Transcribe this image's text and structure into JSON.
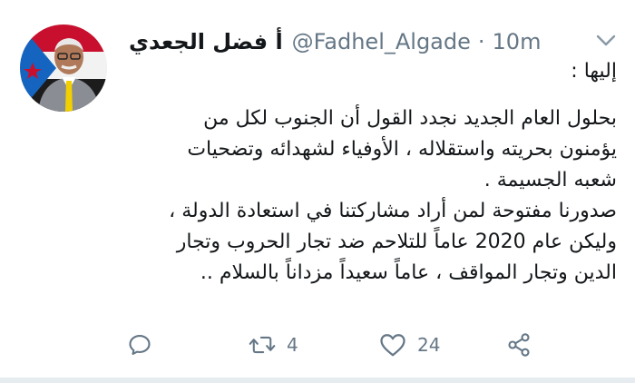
{
  "tweet": {
    "display_name": "أ فضل الجعدي",
    "handle": "@Fadhel_Algade",
    "separator": "·",
    "time": "10m",
    "body_lines": [
      "إليها :",
      "",
      "بحلول العام الجديد نجدد القول أن الجنوب لكل من",
      "يؤمنون بحريته واستقلاله ، الأوفياء لشهدائه وتضحيات",
      "شعبه الجسيمة .",
      "صدورنا مفتوحة لمن أراد مشاركتنا في استعادة الدولة ،",
      "وليكن عام 2020 عاماً للتلاحم ضد تجار الحروب وتجار",
      "الدين وتجار المواقف ، عاماً سعيداً مزداناً بالسلام .."
    ],
    "actions": {
      "reply_icon": "reply-icon",
      "retweet_icon": "retweet-icon",
      "retweet_count": "4",
      "like_icon": "heart-icon",
      "like_count": "24",
      "share_icon": "share-icon"
    }
  },
  "colors": {
    "text": "#14171a",
    "muted": "#657786",
    "divider": "#e6ecf0"
  }
}
